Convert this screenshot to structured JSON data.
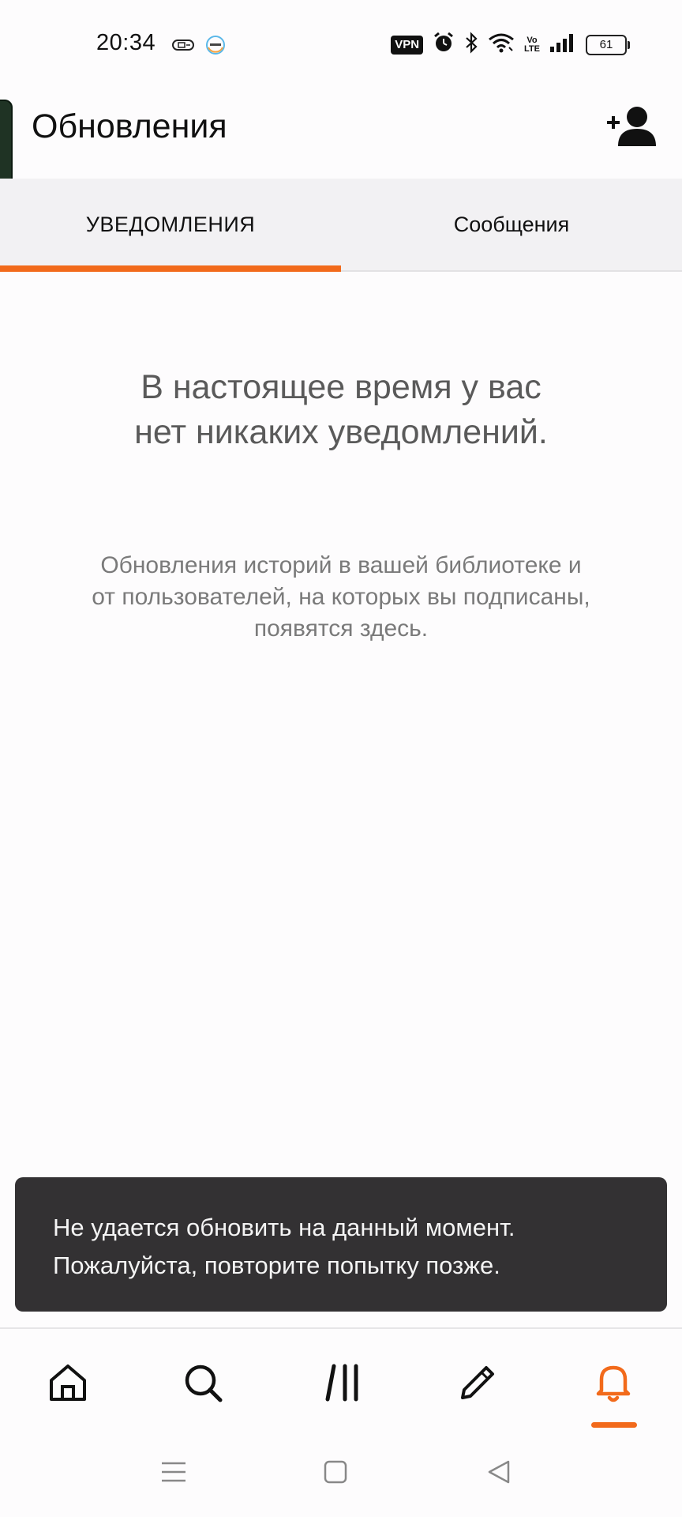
{
  "status_bar": {
    "time": "20:34",
    "vpn": "VPN",
    "battery": "61",
    "lte_top": "Vo",
    "lte_bottom": "LTE"
  },
  "header": {
    "title": "Обновления"
  },
  "tabs": [
    {
      "label": "УВЕДОМЛЕНИЯ",
      "active": true
    },
    {
      "label": "Сообщения",
      "active": false
    }
  ],
  "empty_state": {
    "title_line1": "В настоящее время у вас",
    "title_line2": "нет никаких уведомлений.",
    "desc_line1": "Обновления историй в вашей библиотеке и",
    "desc_line2": "от пользователей, на которых вы подписаны,",
    "desc_line3": "появятся здесь."
  },
  "snackbar": {
    "line1": "Не удается обновить на данный момент.",
    "line2": "Пожалуйста, повторите попытку позже."
  },
  "bottom_nav": {
    "items": [
      {
        "icon": "home-icon",
        "active": false
      },
      {
        "icon": "search-icon",
        "active": false
      },
      {
        "icon": "library-icon",
        "active": false
      },
      {
        "icon": "pencil-icon",
        "active": false
      },
      {
        "icon": "bell-icon",
        "active": true
      }
    ]
  },
  "colors": {
    "accent": "#f26a1b",
    "snackbar_bg": "#333133",
    "tab_bg": "#f2f1f3"
  }
}
